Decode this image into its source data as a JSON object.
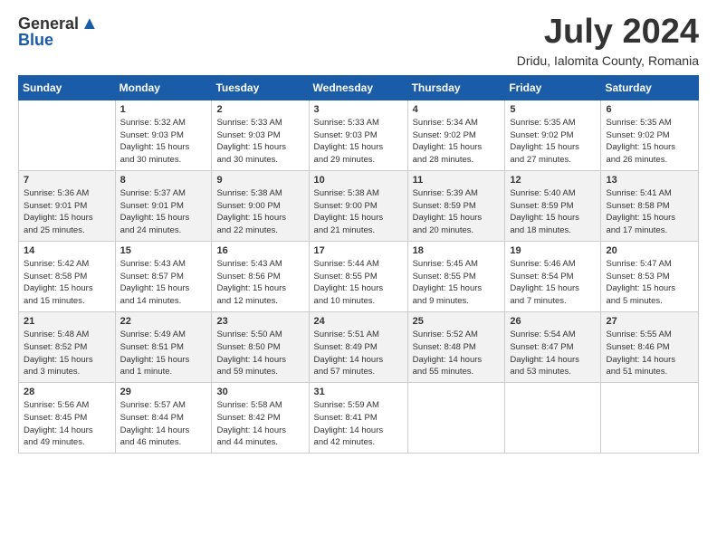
{
  "header": {
    "logo_general": "General",
    "logo_blue": "Blue",
    "month_title": "July 2024",
    "location": "Dridu, Ialomita County, Romania"
  },
  "days_of_week": [
    "Sunday",
    "Monday",
    "Tuesday",
    "Wednesday",
    "Thursday",
    "Friday",
    "Saturday"
  ],
  "weeks": [
    [
      {
        "day": "",
        "info": ""
      },
      {
        "day": "1",
        "info": "Sunrise: 5:32 AM\nSunset: 9:03 PM\nDaylight: 15 hours\nand 30 minutes."
      },
      {
        "day": "2",
        "info": "Sunrise: 5:33 AM\nSunset: 9:03 PM\nDaylight: 15 hours\nand 30 minutes."
      },
      {
        "day": "3",
        "info": "Sunrise: 5:33 AM\nSunset: 9:03 PM\nDaylight: 15 hours\nand 29 minutes."
      },
      {
        "day": "4",
        "info": "Sunrise: 5:34 AM\nSunset: 9:02 PM\nDaylight: 15 hours\nand 28 minutes."
      },
      {
        "day": "5",
        "info": "Sunrise: 5:35 AM\nSunset: 9:02 PM\nDaylight: 15 hours\nand 27 minutes."
      },
      {
        "day": "6",
        "info": "Sunrise: 5:35 AM\nSunset: 9:02 PM\nDaylight: 15 hours\nand 26 minutes."
      }
    ],
    [
      {
        "day": "7",
        "info": "Sunrise: 5:36 AM\nSunset: 9:01 PM\nDaylight: 15 hours\nand 25 minutes."
      },
      {
        "day": "8",
        "info": "Sunrise: 5:37 AM\nSunset: 9:01 PM\nDaylight: 15 hours\nand 24 minutes."
      },
      {
        "day": "9",
        "info": "Sunrise: 5:38 AM\nSunset: 9:00 PM\nDaylight: 15 hours\nand 22 minutes."
      },
      {
        "day": "10",
        "info": "Sunrise: 5:38 AM\nSunset: 9:00 PM\nDaylight: 15 hours\nand 21 minutes."
      },
      {
        "day": "11",
        "info": "Sunrise: 5:39 AM\nSunset: 8:59 PM\nDaylight: 15 hours\nand 20 minutes."
      },
      {
        "day": "12",
        "info": "Sunrise: 5:40 AM\nSunset: 8:59 PM\nDaylight: 15 hours\nand 18 minutes."
      },
      {
        "day": "13",
        "info": "Sunrise: 5:41 AM\nSunset: 8:58 PM\nDaylight: 15 hours\nand 17 minutes."
      }
    ],
    [
      {
        "day": "14",
        "info": "Sunrise: 5:42 AM\nSunset: 8:58 PM\nDaylight: 15 hours\nand 15 minutes."
      },
      {
        "day": "15",
        "info": "Sunrise: 5:43 AM\nSunset: 8:57 PM\nDaylight: 15 hours\nand 14 minutes."
      },
      {
        "day": "16",
        "info": "Sunrise: 5:43 AM\nSunset: 8:56 PM\nDaylight: 15 hours\nand 12 minutes."
      },
      {
        "day": "17",
        "info": "Sunrise: 5:44 AM\nSunset: 8:55 PM\nDaylight: 15 hours\nand 10 minutes."
      },
      {
        "day": "18",
        "info": "Sunrise: 5:45 AM\nSunset: 8:55 PM\nDaylight: 15 hours\nand 9 minutes."
      },
      {
        "day": "19",
        "info": "Sunrise: 5:46 AM\nSunset: 8:54 PM\nDaylight: 15 hours\nand 7 minutes."
      },
      {
        "day": "20",
        "info": "Sunrise: 5:47 AM\nSunset: 8:53 PM\nDaylight: 15 hours\nand 5 minutes."
      }
    ],
    [
      {
        "day": "21",
        "info": "Sunrise: 5:48 AM\nSunset: 8:52 PM\nDaylight: 15 hours\nand 3 minutes."
      },
      {
        "day": "22",
        "info": "Sunrise: 5:49 AM\nSunset: 8:51 PM\nDaylight: 15 hours\nand 1 minute."
      },
      {
        "day": "23",
        "info": "Sunrise: 5:50 AM\nSunset: 8:50 PM\nDaylight: 14 hours\nand 59 minutes."
      },
      {
        "day": "24",
        "info": "Sunrise: 5:51 AM\nSunset: 8:49 PM\nDaylight: 14 hours\nand 57 minutes."
      },
      {
        "day": "25",
        "info": "Sunrise: 5:52 AM\nSunset: 8:48 PM\nDaylight: 14 hours\nand 55 minutes."
      },
      {
        "day": "26",
        "info": "Sunrise: 5:54 AM\nSunset: 8:47 PM\nDaylight: 14 hours\nand 53 minutes."
      },
      {
        "day": "27",
        "info": "Sunrise: 5:55 AM\nSunset: 8:46 PM\nDaylight: 14 hours\nand 51 minutes."
      }
    ],
    [
      {
        "day": "28",
        "info": "Sunrise: 5:56 AM\nSunset: 8:45 PM\nDaylight: 14 hours\nand 49 minutes."
      },
      {
        "day": "29",
        "info": "Sunrise: 5:57 AM\nSunset: 8:44 PM\nDaylight: 14 hours\nand 46 minutes."
      },
      {
        "day": "30",
        "info": "Sunrise: 5:58 AM\nSunset: 8:42 PM\nDaylight: 14 hours\nand 44 minutes."
      },
      {
        "day": "31",
        "info": "Sunrise: 5:59 AM\nSunset: 8:41 PM\nDaylight: 14 hours\nand 42 minutes."
      },
      {
        "day": "",
        "info": ""
      },
      {
        "day": "",
        "info": ""
      },
      {
        "day": "",
        "info": ""
      }
    ]
  ]
}
